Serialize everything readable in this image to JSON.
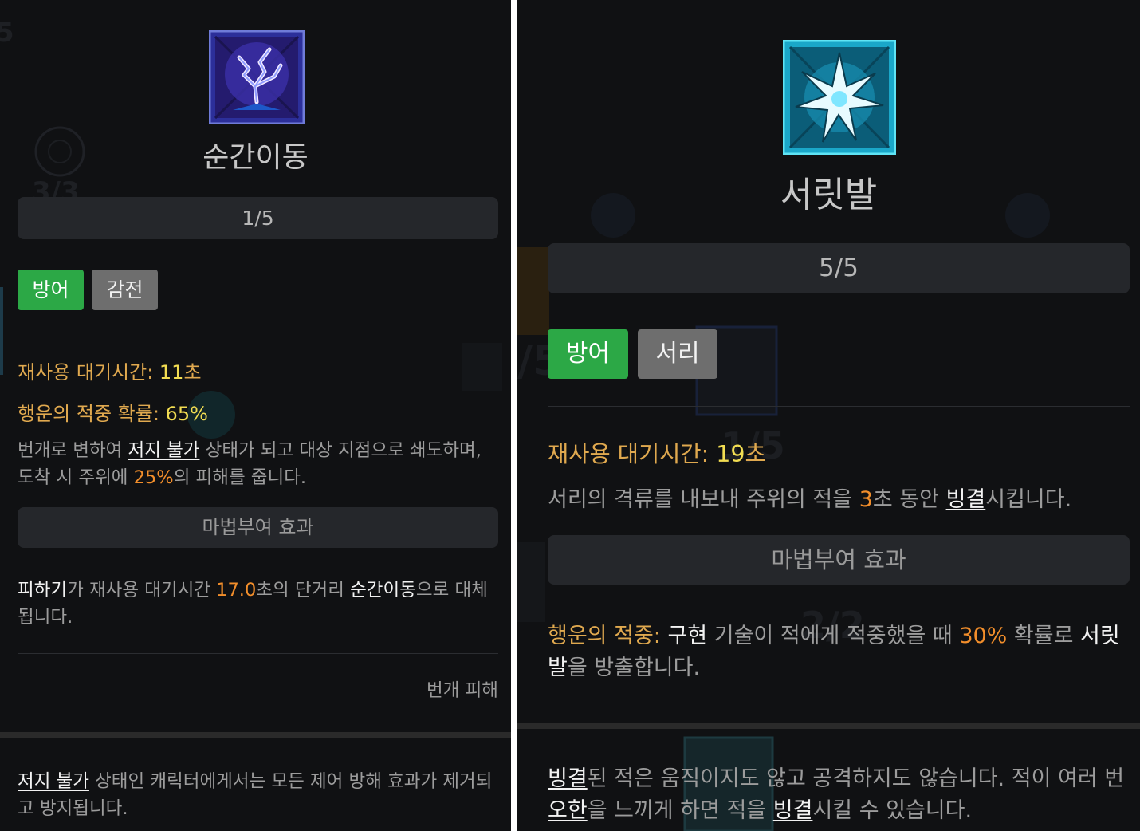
{
  "left": {
    "skill_name": "순간이동",
    "rank": "1/5",
    "tags": [
      "방어",
      "감전"
    ],
    "cooldown": {
      "label": "재사용 대기시간: ",
      "value": "11",
      "unit": "초"
    },
    "lucky_hit": {
      "label": "행운의 적중 확률: ",
      "value": "65%"
    },
    "description": {
      "p1": "번개로 변하여 ",
      "kw1": "저지 불가",
      "p2": " 상태가 되고 대상 지점으로 쇄도하며, 도착 시 주위에 ",
      "num": "25%",
      "p3": "의 피해를 줍니다."
    },
    "enchant_header": "마법부여 효과",
    "enchant": {
      "b1": "피하기",
      "p1": "가 재사용 대기시간 ",
      "num": "17.0",
      "p2": "초의 단거리 ",
      "b2": "순간이동",
      "p3": "으로 대체됩니다."
    },
    "damage_type": "번개 피해",
    "footnote": {
      "kw": "저지 불가",
      "text": " 상태인 캐릭터에게서는 모든 제어 방해 효과가 제거되고 방지됩니다."
    },
    "bg_text": [
      "3/3",
      "5"
    ]
  },
  "right": {
    "skill_name": "서릿발",
    "rank": "5/5",
    "tags": [
      "방어",
      "서리"
    ],
    "cooldown": {
      "label": "재사용 대기시간: ",
      "value": "19",
      "unit": "초"
    },
    "description": {
      "p1": "서리의 격류를 내보내 주위의 적을 ",
      "num": "3",
      "p2": "초 동안 ",
      "kw": "빙결",
      "p3": "시킵니다."
    },
    "enchant_header": "마법부여 효과",
    "enchant": {
      "label": "행운의 적중: ",
      "b1": "구현",
      "p1": " 기술이 적에게 적중했을 때 ",
      "num": "30%",
      "p2": " 확률로 ",
      "b2": "서릿발",
      "p3": "을 방출합니다."
    },
    "footnote": {
      "kw1": "빙결",
      "p1": "된 적은 움직이지도 않고 공격하지도 않습니다. 적이 여러 번 ",
      "kw2": "오한",
      "p2": "을 느끼게 하면 적을 ",
      "kw3": "빙결",
      "p3": "시킬 수 있습니다."
    },
    "bg_text": [
      "1/5",
      "2/2",
      "/5"
    ]
  },
  "colors": {
    "panel_bg": "#101113",
    "bar_bg": "#25272b",
    "tag_green": "#2ca846",
    "tag_gray": "#6e6e6e",
    "gold_label": "#e0a94f",
    "yellow_value": "#f2dd52",
    "orange_number": "#f28e2b"
  }
}
